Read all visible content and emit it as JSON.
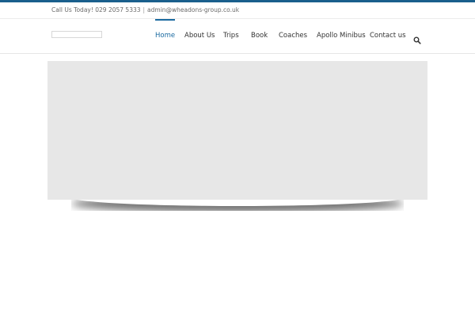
{
  "top_bar": {
    "phone_text": "Call Us Today! 029 2057 5333",
    "separator": "|",
    "email_text": "admin@wheadons-group.co.uk"
  },
  "nav": {
    "items": [
      {
        "label": "Home",
        "active": true
      },
      {
        "label": "About Us",
        "active": false
      },
      {
        "label": "Trips",
        "active": false
      },
      {
        "label": "Book",
        "active": false
      },
      {
        "label": "Coaches",
        "active": false
      },
      {
        "label": "Apollo Minibus",
        "active": false
      },
      {
        "label": "Contact us",
        "active": false
      }
    ],
    "search_icon": "search-icon"
  },
  "colors": {
    "accent": "#1a5f8c",
    "nav_active": "#1a6aa0",
    "slider_bg": "#e7e7e7"
  }
}
